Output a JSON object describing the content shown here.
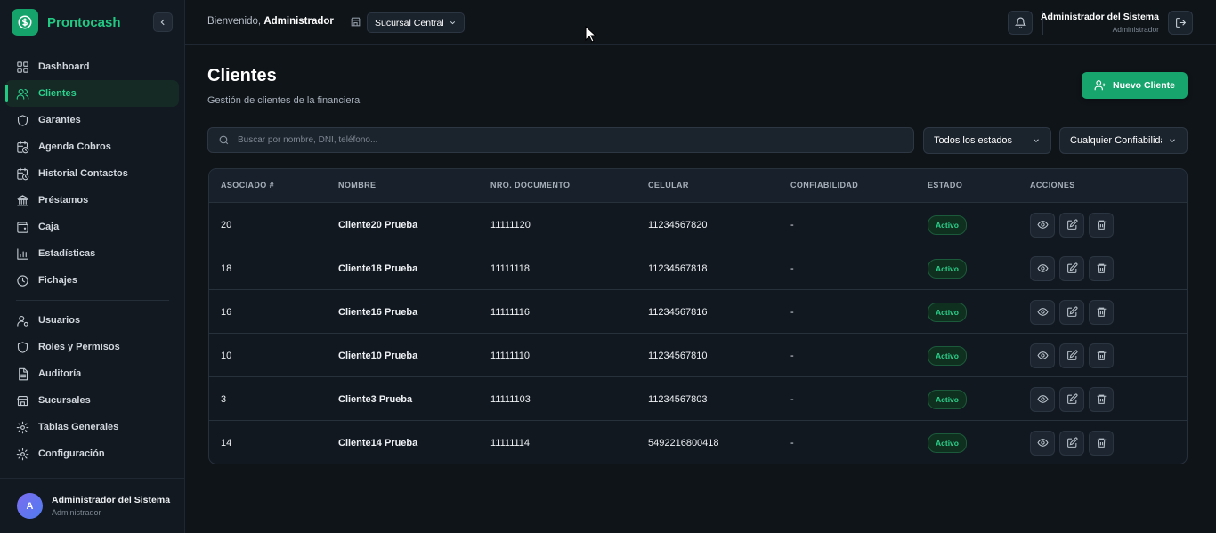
{
  "brand": {
    "name": "Prontocash"
  },
  "sidebar": {
    "items": [
      {
        "label": "Dashboard",
        "icon": "grid-icon"
      },
      {
        "label": "Clientes",
        "icon": "users-icon",
        "active": true
      },
      {
        "label": "Garantes",
        "icon": "shield-icon"
      },
      {
        "label": "Agenda Cobros",
        "icon": "calendar-clock-icon"
      },
      {
        "label": "Historial Contactos",
        "icon": "calendar-clock-icon"
      },
      {
        "label": "Préstamos",
        "icon": "bank-icon"
      },
      {
        "label": "Caja",
        "icon": "wallet-icon"
      },
      {
        "label": "Estadísticas",
        "icon": "bar-chart-icon"
      },
      {
        "label": "Fichajes",
        "icon": "clock-icon"
      }
    ],
    "admin_items": [
      {
        "label": "Usuarios",
        "icon": "user-cog-icon"
      },
      {
        "label": "Roles y Permisos",
        "icon": "shield-icon"
      },
      {
        "label": "Auditoría",
        "icon": "document-icon"
      },
      {
        "label": "Sucursales",
        "icon": "store-icon"
      },
      {
        "label": "Tablas Generales",
        "icon": "gear-icon"
      },
      {
        "label": "Configuración",
        "icon": "gear-icon"
      }
    ],
    "footer": {
      "avatar_letter": "A",
      "name": "Administrador del Sistema",
      "role": "Administrador"
    }
  },
  "topbar": {
    "welcome_prefix": "Bienvenido,",
    "welcome_user": "Administrador",
    "branch": "Sucursal Central",
    "user_name": "Administrador del Sistema",
    "user_role": "Administrador"
  },
  "page": {
    "title": "Clientes",
    "subtitle": "Gestión de clientes de la financiera",
    "new_button": "Nuevo Cliente"
  },
  "filters": {
    "search_placeholder": "Buscar por nombre, DNI, teléfono...",
    "status": "Todos los estados",
    "reliability": "Cualquier Confiabilidad"
  },
  "table": {
    "headers": [
      "ASOCIADO #",
      "NOMBRE",
      "NRO. DOCUMENTO",
      "CELULAR",
      "CONFIABILIDAD",
      "ESTADO",
      "ACCIONES"
    ],
    "rows": [
      {
        "id": "20",
        "name": "Cliente20 Prueba",
        "doc": "11111120",
        "phone": "11234567820",
        "reliability": "-",
        "status": "Activo"
      },
      {
        "id": "18",
        "name": "Cliente18 Prueba",
        "doc": "11111118",
        "phone": "11234567818",
        "reliability": "-",
        "status": "Activo"
      },
      {
        "id": "16",
        "name": "Cliente16 Prueba",
        "doc": "11111116",
        "phone": "11234567816",
        "reliability": "-",
        "status": "Activo"
      },
      {
        "id": "10",
        "name": "Cliente10 Prueba",
        "doc": "11111110",
        "phone": "11234567810",
        "reliability": "-",
        "status": "Activo"
      },
      {
        "id": "3",
        "name": "Cliente3 Prueba",
        "doc": "11111103",
        "phone": "11234567803",
        "reliability": "-",
        "status": "Activo"
      },
      {
        "id": "14",
        "name": "Cliente14 Prueba",
        "doc": "11111114",
        "phone": "5492216800418",
        "reliability": "-",
        "status": "Activo"
      }
    ]
  },
  "colors": {
    "accent": "#22c983",
    "button": "#17a56d",
    "background": "#0f1419"
  }
}
